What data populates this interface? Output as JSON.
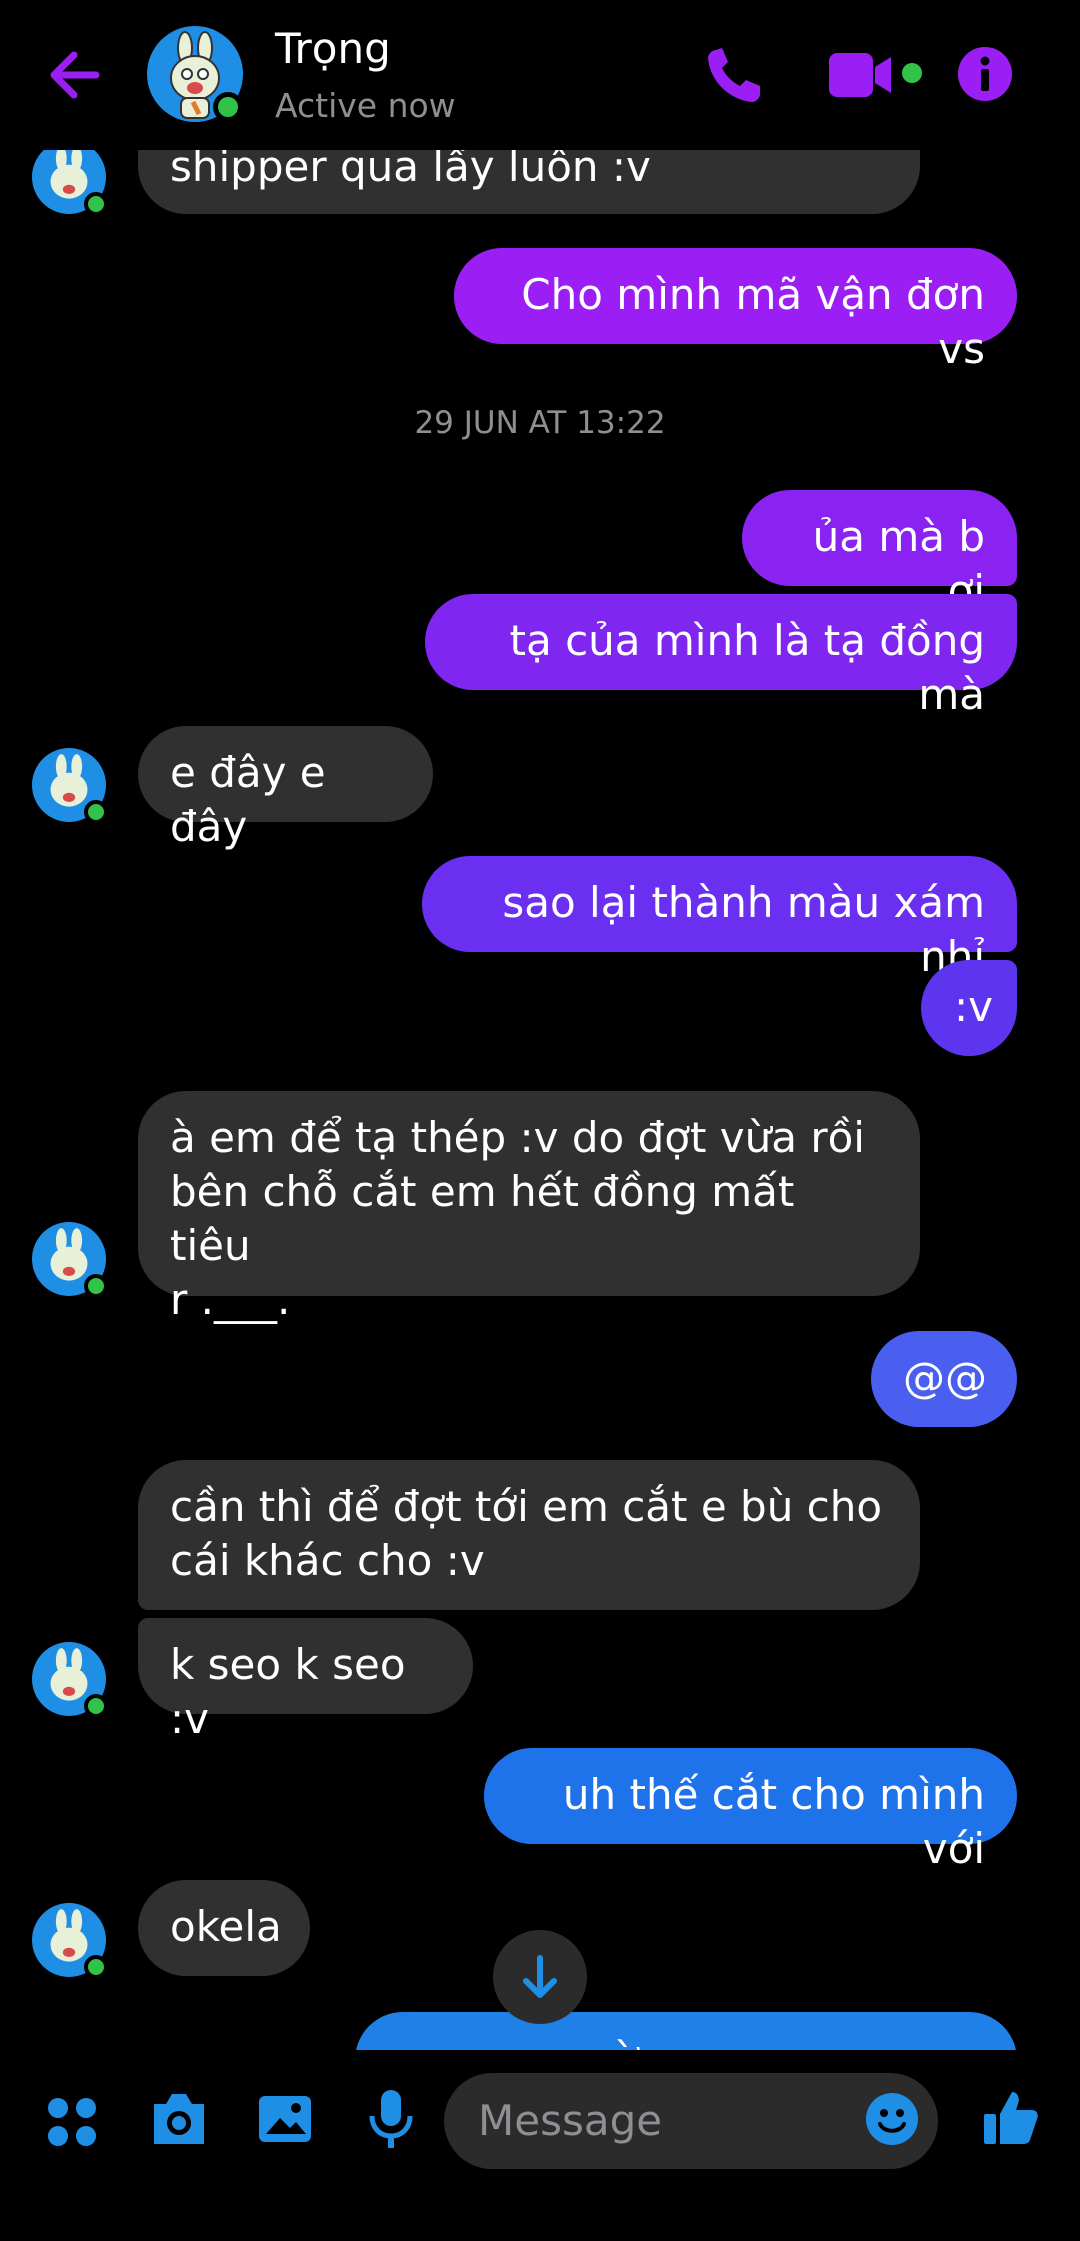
{
  "header": {
    "name": "Trọng",
    "status": "Active now"
  },
  "timestamp": "29 JUN AT 13:22",
  "messages": [
    {
      "id": "m0",
      "side": "in",
      "text": "shipper qua lấy luôn :v"
    },
    {
      "id": "m1",
      "side": "out",
      "text": "Cho mình mã vận đơn vs"
    },
    {
      "id": "m2",
      "side": "out",
      "text": "ủa mà b ơi"
    },
    {
      "id": "m3",
      "side": "out",
      "text": "tạ của mình là tạ đồng mà"
    },
    {
      "id": "m4",
      "side": "in",
      "text": "e đây e đây"
    },
    {
      "id": "m5",
      "side": "out",
      "text": "sao lại thành màu xám nhỉ"
    },
    {
      "id": "m6",
      "side": "out",
      "text": ":v"
    },
    {
      "id": "m7",
      "side": "in",
      "text": "à em để tạ thép :v do đợt vừa rồi\nbên chỗ cắt em hết đồng mất tiêu\nr .___."
    },
    {
      "id": "m8",
      "side": "out",
      "text": "@@"
    },
    {
      "id": "m9",
      "side": "in",
      "text": "cần thì để đợt tới em cắt e bù cho\ncái khác cho :v"
    },
    {
      "id": "m10",
      "side": "in",
      "text": "k seo k seo :v"
    },
    {
      "id": "m11",
      "side": "out",
      "text": "uh thế cắt cho mình với"
    },
    {
      "id": "m12",
      "side": "in",
      "text": "okela"
    },
    {
      "id": "m13",
      "side": "out",
      "text": "ừ ...  ... ... ...  ... ..."
    }
  ],
  "composer": {
    "placeholder": "Message"
  },
  "colors": {
    "accent": "#9b1ff5",
    "incoming_bubble": "#303030",
    "online": "#31c24a",
    "composer_icons": "#1f8fe6"
  },
  "icons": [
    "back-arrow-icon",
    "phone-icon",
    "video-camera-icon",
    "info-icon",
    "menu-dots-icon",
    "camera-icon",
    "gallery-icon",
    "microphone-icon",
    "emoji-icon",
    "like-icon",
    "arrow-down-icon"
  ]
}
